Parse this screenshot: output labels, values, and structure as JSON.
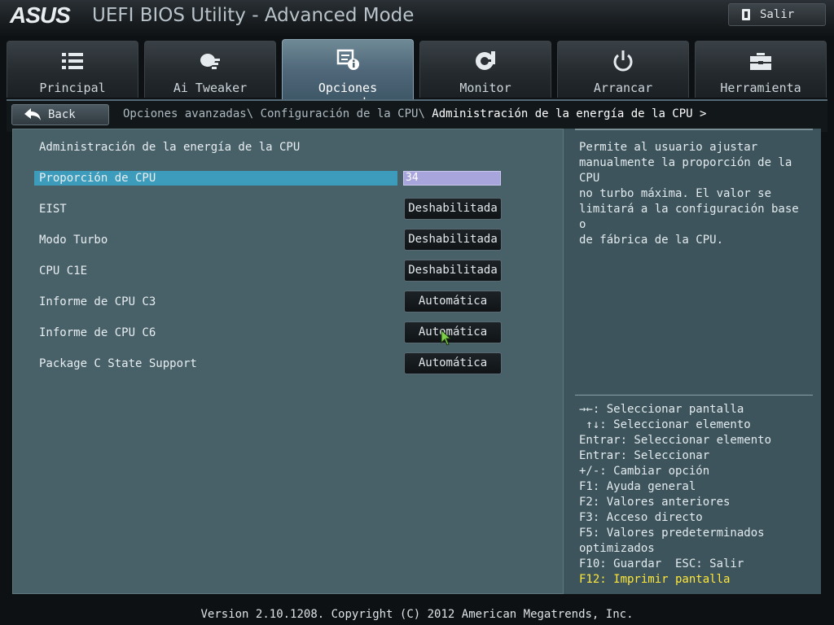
{
  "window": {
    "brand": "ASUS",
    "title": "UEFI BIOS Utility - Advanced Mode",
    "exit_label": "Salir"
  },
  "tabs": [
    {
      "label": "Principal",
      "icon": "list-icon",
      "active": false
    },
    {
      "label": "Ai Tweaker",
      "icon": "tweaker-icon",
      "active": false
    },
    {
      "label": "Opciones avanzadas",
      "icon": "advanced-info-icon",
      "active": true
    },
    {
      "label": "Monitor",
      "icon": "monitor-gauge-icon",
      "active": false
    },
    {
      "label": "Arrancar",
      "icon": "power-icon",
      "active": false
    },
    {
      "label": "Herramienta",
      "icon": "toolbox-icon",
      "active": false
    }
  ],
  "nav": {
    "back_label": "Back",
    "breadcrumb": [
      "Opciones avanzadas\\ ",
      "Configuración de la CPU\\ ",
      "Administración de la energía de la CPU >"
    ]
  },
  "section": {
    "title": "Administración de la energía de la CPU"
  },
  "settings": [
    {
      "label": "Proporción de CPU",
      "value": "34",
      "kind": "input",
      "selected": true
    },
    {
      "label": "EIST",
      "value": "Deshabilitada",
      "kind": "button"
    },
    {
      "label": "Modo Turbo",
      "value": "Deshabilitada",
      "kind": "button"
    },
    {
      "label": "CPU C1E",
      "value": "Deshabilitada",
      "kind": "button"
    },
    {
      "label": "Informe de CPU C3",
      "value": "Automática",
      "kind": "button"
    },
    {
      "label": "Informe de CPU C6",
      "value": "Automática",
      "kind": "button"
    },
    {
      "label": "Package C State Support",
      "value": "Automática",
      "kind": "button"
    }
  ],
  "help": {
    "text": "Permite al usuario ajustar\nmanualmente la proporción de la CPU\nno turbo máxima. El valor se\nlimitará a la configuración base o\nde fábrica de la CPU."
  },
  "keys": [
    "→←: Seleccionar pantalla",
    " ↑↓: Seleccionar elemento",
    "Entrar: Seleccionar elemento",
    "Entrar: Seleccionar",
    "+/-: Cambiar opción",
    "F1: Ayuda general",
    "F2: Valores anteriores",
    "F3: Acceso directo",
    "F5: Valores predeterminados",
    "optimizados",
    "F10: Guardar  ESC: Salir",
    "F12: Imprimir pantalla"
  ],
  "footer": {
    "text": "Version 2.10.1208. Copyright (C) 2012 American Megatrends, Inc."
  },
  "colors": {
    "accent_highlight": "#3d9cbc",
    "value_input_bg": "#a8a4dc",
    "f12_key": "#ffe83a"
  }
}
